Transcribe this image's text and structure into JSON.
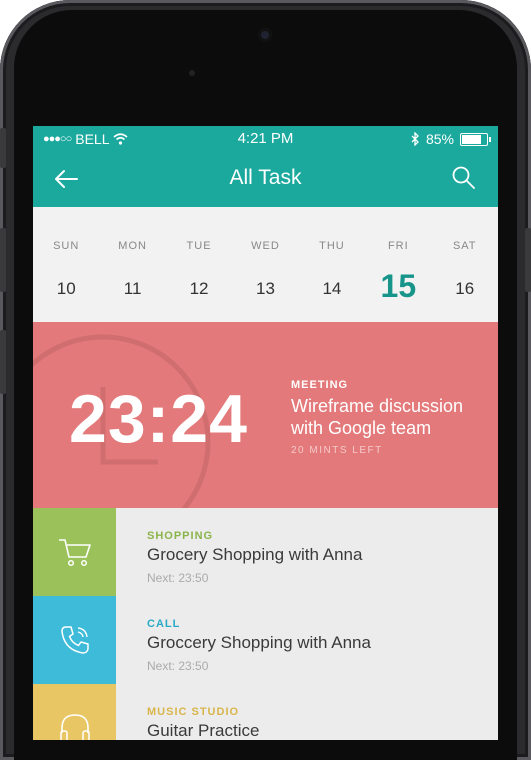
{
  "status_bar": {
    "signal": "●●●○○",
    "carrier": "BELL",
    "time": "4:21 PM",
    "battery": "85%",
    "battery_level": 0.85
  },
  "nav": {
    "title": "All Task",
    "back_icon": "arrow-left-icon",
    "search_icon": "search-icon"
  },
  "calendar": {
    "days": [
      {
        "dow": "SUN",
        "date": "10"
      },
      {
        "dow": "MON",
        "date": "11"
      },
      {
        "dow": "TUE",
        "date": "12"
      },
      {
        "dow": "WED",
        "date": "13"
      },
      {
        "dow": "THU",
        "date": "14"
      },
      {
        "dow": "FRI",
        "date": "15"
      },
      {
        "dow": "SAT",
        "date": "16"
      }
    ],
    "selected_index": 5
  },
  "featured": {
    "time": "23:24",
    "category": "MEETING",
    "title_line1": "Wireframe discussion",
    "title_line2": "with Google team",
    "time_left": "20 MINTS LEFT",
    "color": "#e3797a"
  },
  "tasks": [
    {
      "category": "SHOPPING",
      "title": "Grocery Shopping with Anna",
      "next": "Next: 23:50",
      "icon": "cart-icon",
      "color": "#9bc25a",
      "category_color": "#8bb44a"
    },
    {
      "category": "CALL",
      "title": "Groccery Shopping with Anna",
      "next": "Next: 23:50",
      "icon": "phone-icon",
      "color": "#3dbbd8",
      "category_color": "#2aa9c6"
    },
    {
      "category": "MUSIC STUDIO",
      "title": "Guitar Practice",
      "next": "",
      "icon": "headphones-icon",
      "color": "#e9c664",
      "category_color": "#d9b54b"
    }
  ],
  "colors": {
    "header": "#1ba99e",
    "accent": "#17958b"
  }
}
